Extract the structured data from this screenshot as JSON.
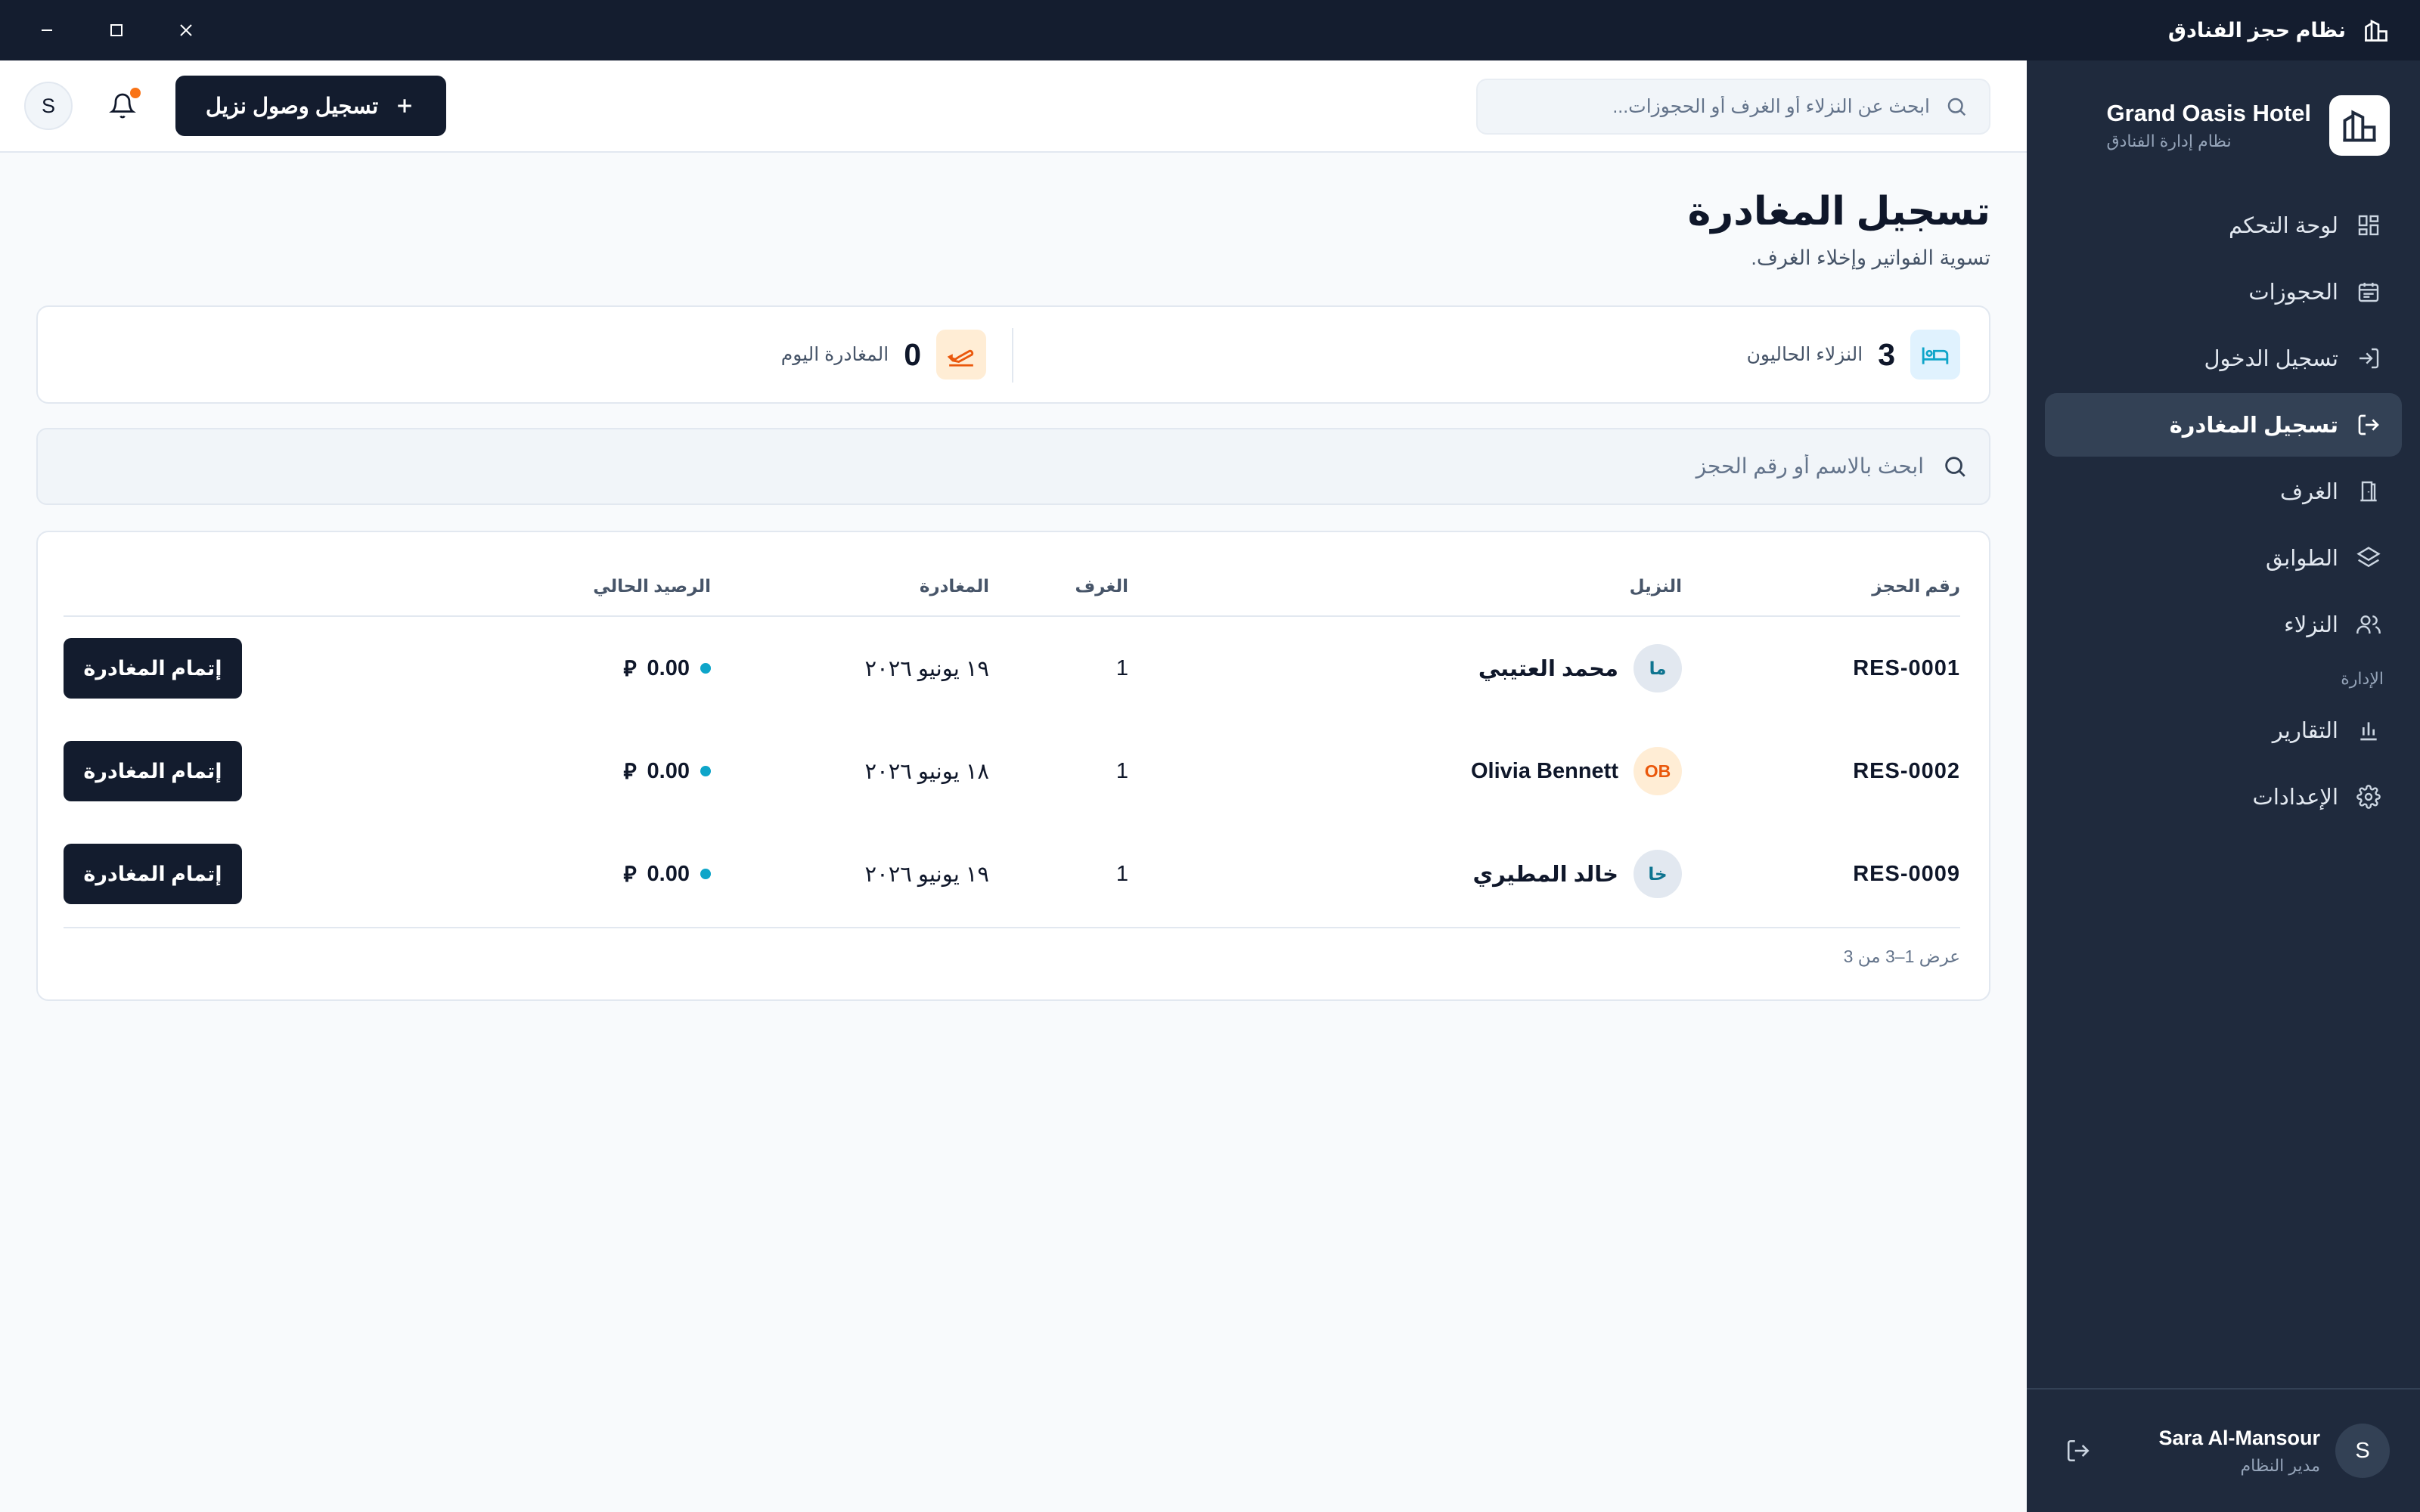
{
  "window": {
    "title": "نظام حجز الفنادق",
    "minimize_icon": "minimize-icon",
    "maximize_icon": "maximize-icon",
    "close_icon": "close-icon"
  },
  "sidebar": {
    "brand_name": "Grand Oasis Hotel",
    "brand_sub": "نظام إدارة الفنادق",
    "items": [
      {
        "label": "لوحة التحكم",
        "icon": "dashboard-icon"
      },
      {
        "label": "الحجوزات",
        "icon": "calendar-icon"
      },
      {
        "label": "تسجيل الدخول",
        "icon": "login-icon"
      },
      {
        "label": "تسجيل المغادرة",
        "icon": "logout-icon",
        "active": true
      },
      {
        "label": "الغرف",
        "icon": "door-icon"
      },
      {
        "label": "الطوابق",
        "icon": "layers-icon"
      },
      {
        "label": "النزلاء",
        "icon": "users-icon"
      }
    ],
    "section_admin": "الإدارة",
    "admin_items": [
      {
        "label": "التقارير",
        "icon": "bar-chart-icon"
      },
      {
        "label": "الإعدادات",
        "icon": "gear-icon"
      }
    ],
    "user": {
      "initial": "S",
      "name": "Sara Al-Mansour",
      "role": "مدير النظام"
    }
  },
  "header": {
    "search_placeholder": "ابحث عن النزلاء أو الغرف أو الحجوزات...",
    "checkin_button": "تسجيل وصول نزيل",
    "avatar_initial": "S",
    "has_notification": true
  },
  "page": {
    "title": "تسجيل المغادرة",
    "subtitle": "تسوية الفواتير وإخلاء الغرف."
  },
  "stats": {
    "current_guests": {
      "value": "3",
      "label": "النزلاء الحاليون"
    },
    "departures_today": {
      "value": "0",
      "label": "المغادرة اليوم"
    }
  },
  "filter": {
    "placeholder": "ابحث بالاسم أو رقم الحجز"
  },
  "table": {
    "columns": [
      "رقم الحجز",
      "النزيل",
      "الغرف",
      "المغادرة",
      "الرصيد الحالي"
    ],
    "rows": [
      {
        "id": "RES-0001",
        "initials": "ما",
        "guest": "محمد العتيبي",
        "rooms": "1",
        "departure": "١٩ يونيو ٢٠٢٦",
        "balance": "0.00",
        "currency": "⃁",
        "action": "إتمام المغادرة"
      },
      {
        "id": "RES-0002",
        "initials": "OB",
        "guest": "Olivia Bennett",
        "rooms": "1",
        "departure": "١٨ يونيو ٢٠٢٦",
        "balance": "0.00",
        "currency": "⃁",
        "action": "إتمام المغادرة"
      },
      {
        "id": "RES-0009",
        "initials": "خا",
        "guest": "خالد المطيري",
        "rooms": "1",
        "departure": "١٩ يونيو ٢٠٢٦",
        "balance": "0.00",
        "currency": "⃁",
        "action": "إتمام المغادرة"
      }
    ],
    "pagination": "عرض 1–3 من 3"
  },
  "colors": {
    "accent_dark": "#131c2e",
    "sidebar_bg": "#1f2a3d",
    "teal": "#0ea5c9",
    "orange": "#ea580c"
  }
}
